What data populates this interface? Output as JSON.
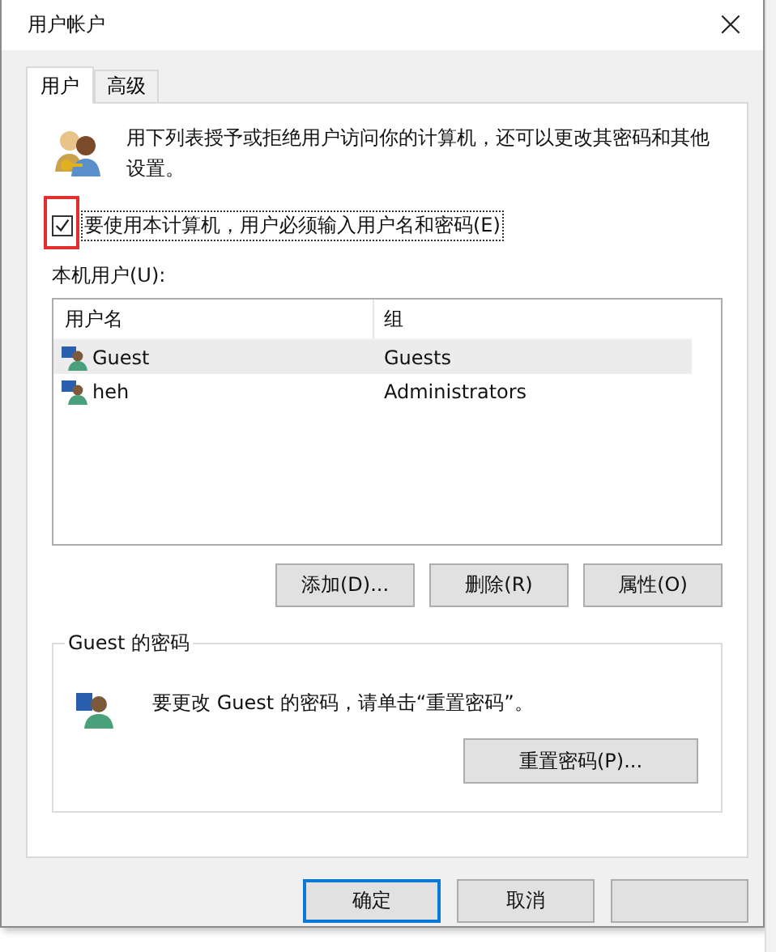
{
  "window": {
    "title": "用户帐户",
    "close": "×"
  },
  "tabs": [
    {
      "label": "用户",
      "selected": true
    },
    {
      "label": "高级",
      "selected": false
    }
  ],
  "intro": "用下列表授予或拒绝用户访问你的计算机，还可以更改其密码和其他设置。",
  "require_login": {
    "label": "要使用本计算机，用户必须输入用户名和密码(E)",
    "checked": true,
    "focused": true,
    "highlighted": true
  },
  "users_label": "本机用户(U):",
  "table": {
    "columns": [
      "用户名",
      "组"
    ],
    "rows": [
      {
        "name": "Guest",
        "group": "Guests",
        "selected": true
      },
      {
        "name": "heh",
        "group": "Administrators",
        "selected": false
      }
    ]
  },
  "user_buttons": [
    "添加(D)...",
    "删除(R)",
    "属性(O)"
  ],
  "password_group": {
    "title": "Guest 的密码",
    "text": "要更改 Guest 的密码，请单击“重置密码”。",
    "button": "重置密码(P)..."
  },
  "dialog_buttons": [
    {
      "label": "确定",
      "default": true
    },
    {
      "label": "取消",
      "default": false
    },
    {
      "default": false
    }
  ]
}
